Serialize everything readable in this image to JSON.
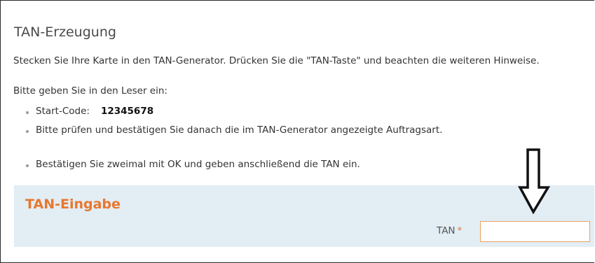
{
  "section": {
    "title": "TAN-Erzeugung",
    "instruction": "Stecken Sie Ihre Karte in den TAN-Generator. Drücken Sie die \"TAN-Taste\" und beachten die weiteren Hinweise.",
    "reader_prompt": "Bitte geben Sie in den Leser ein:",
    "steps": [
      {
        "label": "Start-Code:",
        "value": "12345678"
      },
      {
        "label": "Bitte prüfen und bestätigen Sie danach die im TAN-Generator angezeigte Auftragsart."
      },
      {
        "label": "Bestätigen Sie zweimal mit OK und geben anschließend die TAN ein."
      }
    ]
  },
  "tan_entry": {
    "title": "TAN-Eingabe",
    "label": "TAN",
    "required_marker": "*",
    "value": "",
    "placeholder": ""
  },
  "annotation": {
    "icon": "down-arrow-icon"
  },
  "colors": {
    "accent": "#e8772e",
    "panel_background": "#e3edf4",
    "input_border": "#e8a262",
    "text": "#333333"
  }
}
